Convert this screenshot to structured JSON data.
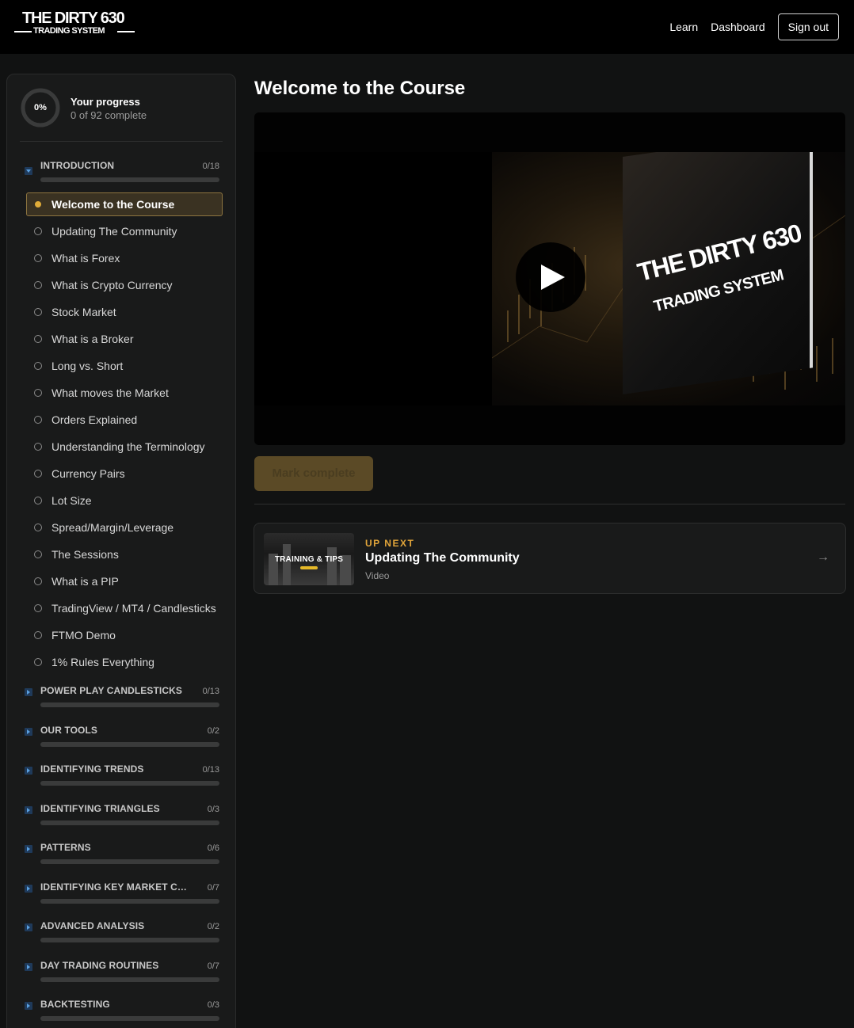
{
  "header": {
    "logo_line1": "THE DIRTY 630",
    "logo_line2": "TRADING SYSTEM",
    "nav": {
      "learn": "Learn",
      "dashboard": "Dashboard",
      "signout": "Sign out"
    }
  },
  "progress": {
    "percent_label": "0%",
    "percent": 0,
    "title": "Your progress",
    "subtitle": "0 of 92 complete"
  },
  "sections": [
    {
      "title": "INTRODUCTION",
      "count": "0/18",
      "expanded": true,
      "progress": 0,
      "lessons": [
        {
          "label": "Welcome to the Course",
          "active": true
        },
        {
          "label": "Updating The Community"
        },
        {
          "label": "What is Forex"
        },
        {
          "label": "What is Crypto Currency"
        },
        {
          "label": "Stock Market"
        },
        {
          "label": "What is a Broker"
        },
        {
          "label": "Long vs. Short"
        },
        {
          "label": "What moves the Market"
        },
        {
          "label": "Orders Explained"
        },
        {
          "label": "Understanding the Terminology"
        },
        {
          "label": "Currency Pairs"
        },
        {
          "label": "Lot Size"
        },
        {
          "label": "Spread/Margin/Leverage"
        },
        {
          "label": "The Sessions"
        },
        {
          "label": "What is a PIP"
        },
        {
          "label": "TradingView / MT4 / Candlesticks"
        },
        {
          "label": "FTMO Demo"
        },
        {
          "label": "1% Rules Everything"
        }
      ]
    },
    {
      "title": "POWER PLAY CANDLESTICKS",
      "count": "0/13",
      "expanded": false,
      "progress": 0
    },
    {
      "title": "OUR TOOLS",
      "count": "0/2",
      "expanded": false,
      "progress": 0
    },
    {
      "title": "IDENTIFYING TRENDS",
      "count": "0/13",
      "expanded": false,
      "progress": 0
    },
    {
      "title": "IDENTIFYING TRIANGLES",
      "count": "0/3",
      "expanded": false,
      "progress": 0
    },
    {
      "title": "PATTERNS",
      "count": "0/6",
      "expanded": false,
      "progress": 0
    },
    {
      "title": "IDENTIFYING KEY MARKET COMP...",
      "count": "0/7",
      "expanded": false,
      "progress": 0
    },
    {
      "title": "ADVANCED ANALYSIS",
      "count": "0/2",
      "expanded": false,
      "progress": 0
    },
    {
      "title": "DAY TRADING ROUTINES",
      "count": "0/7",
      "expanded": false,
      "progress": 0
    },
    {
      "title": "BACKTESTING",
      "count": "0/3",
      "expanded": false,
      "progress": 0
    }
  ],
  "main": {
    "title": "Welcome to the Course",
    "video": {
      "brand_line1": "THE DIRTY 630",
      "brand_line2": "TRADING SYSTEM",
      "play_icon": "play-icon"
    },
    "mark_complete": "Mark complete",
    "up_next": {
      "label": "UP NEXT",
      "title": "Updating The Community",
      "type": "Video",
      "thumbnail_text": "TRAINING & TIPS",
      "arrow": "→"
    }
  },
  "colors": {
    "accent": "#e0ac39",
    "background": "#111212",
    "panel": "#191a1a",
    "active_bg": "#3a3222"
  }
}
